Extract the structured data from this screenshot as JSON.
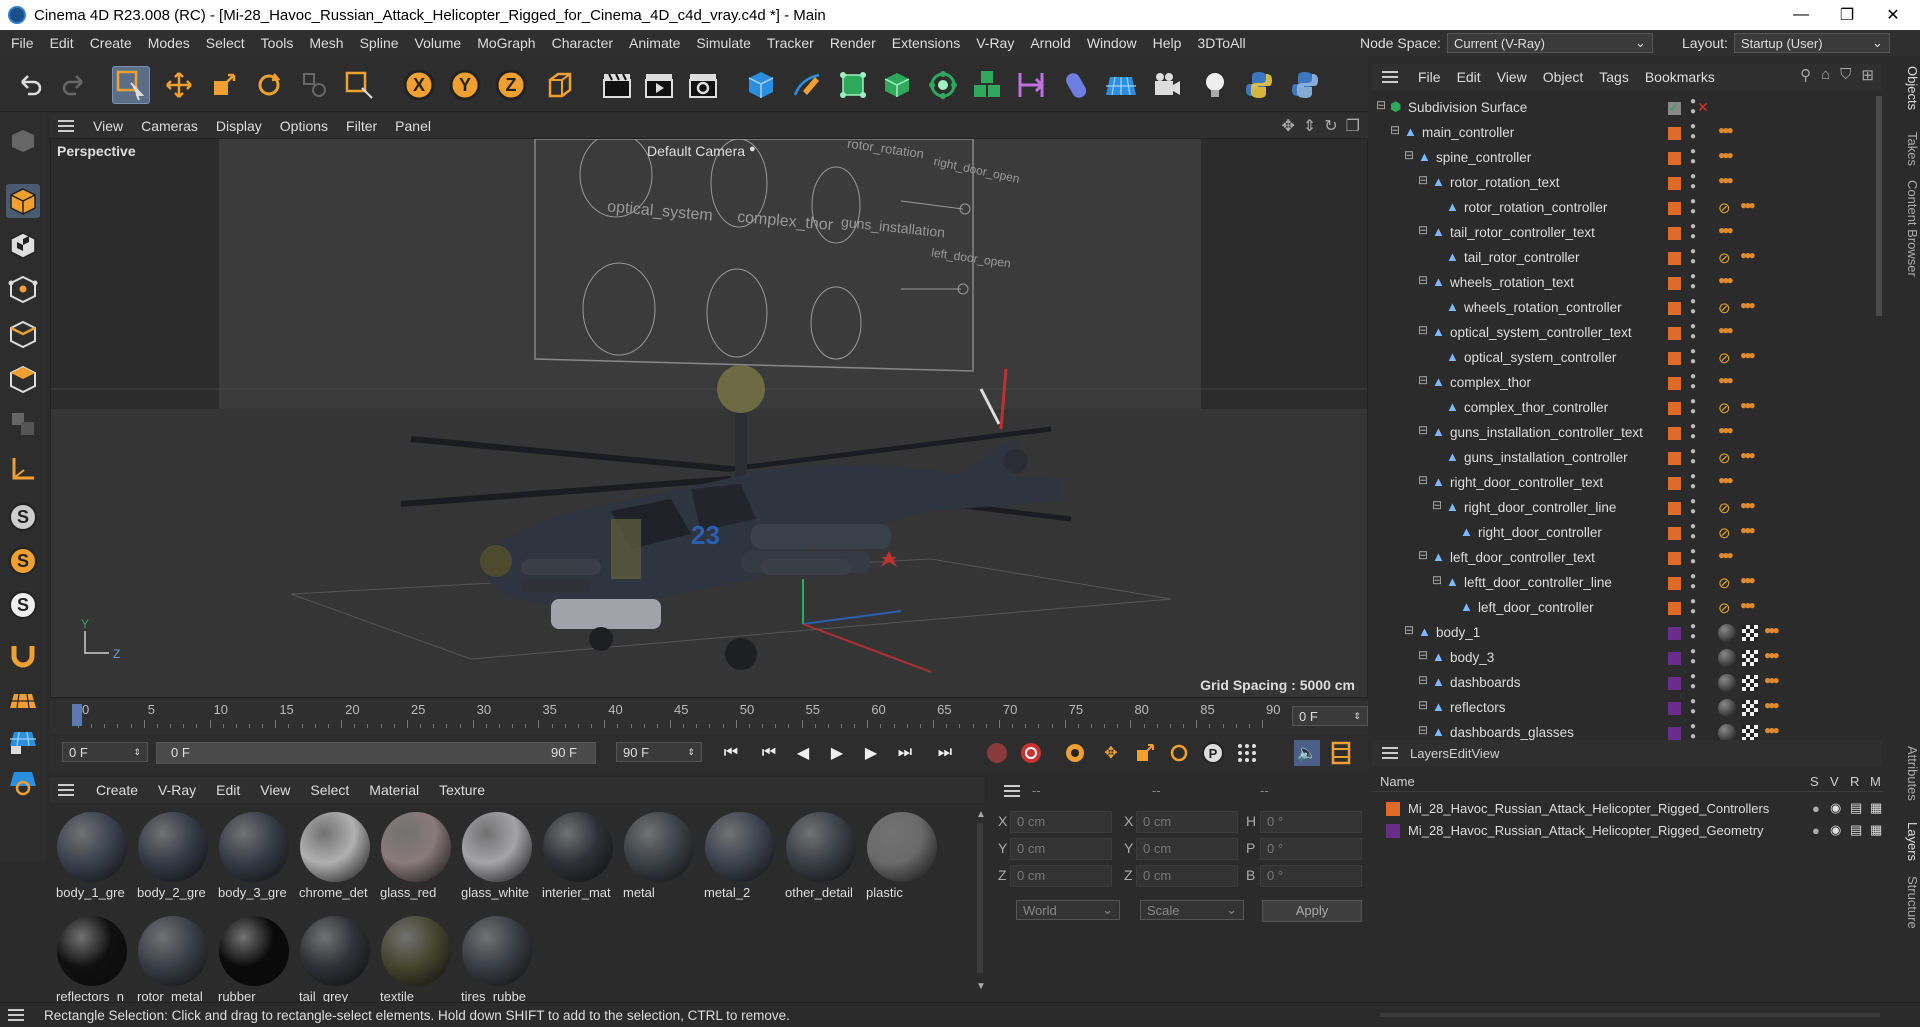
{
  "window": {
    "title": "Cinema 4D R23.008 (RC) - [Mi-28_Havoc_Russian_Attack_Helicopter_Rigged_for_Cinema_4D_c4d_vray.c4d *] - Main",
    "min": "—",
    "max": "❐",
    "close": "✕"
  },
  "menubar": {
    "items": [
      "File",
      "Edit",
      "Create",
      "Modes",
      "Select",
      "Tools",
      "Mesh",
      "Spline",
      "Volume",
      "MoGraph",
      "Character",
      "Animate",
      "Simulate",
      "Tracker",
      "Render",
      "Extensions",
      "V-Ray",
      "Arnold",
      "Window",
      "Help",
      "3DToAll"
    ],
    "node_space_label": "Node Space:",
    "node_space_value": "Current (V-Ray)",
    "layout_label": "Layout:",
    "layout_value": "Startup (User)"
  },
  "viewport": {
    "menu": [
      "View",
      "Cameras",
      "Display",
      "Options",
      "Filter",
      "Panel"
    ],
    "name": "Perspective",
    "camera": "Default Camera",
    "grid_spacing": "Grid Spacing : 5000 cm",
    "labels": {
      "rotor": "rotor_rotation",
      "right_door": "right_door_open",
      "optical": "optical_system",
      "complex": "complex_thor",
      "guns": "guns_installation",
      "left_door": "left_door_open"
    },
    "axis_y": "Y",
    "axis_z": "Z"
  },
  "timeline": {
    "ticks": [
      "0",
      "5",
      "10",
      "15",
      "20",
      "25",
      "30",
      "35",
      "40",
      "45",
      "50",
      "55",
      "60",
      "65",
      "70",
      "75",
      "80",
      "85",
      "90"
    ],
    "current_frame": "0 F"
  },
  "timecontrol": {
    "start": "0 F",
    "range_start": "0 F",
    "range_end": "90 F",
    "end": "90 F"
  },
  "materials": {
    "menu": [
      "Create",
      "V-Ray",
      "Edit",
      "View",
      "Select",
      "Material",
      "Texture"
    ],
    "items": [
      {
        "name": "body_1_gre",
        "color": "#3b4350"
      },
      {
        "name": "body_2_gre",
        "color": "#353c48"
      },
      {
        "name": "body_3_gre",
        "color": "#363d48"
      },
      {
        "name": "chrome_det",
        "color": "#b0b0b0"
      },
      {
        "name": "glass_red",
        "color": "#8a7a7c"
      },
      {
        "name": "glass_white",
        "color": "#a3a3a8"
      },
      {
        "name": "interier_mat",
        "color": "#2e3238"
      },
      {
        "name": "metal",
        "color": "#3c4248"
      },
      {
        "name": "metal_2",
        "color": "#3d4450"
      },
      {
        "name": "other_detail",
        "color": "#3a4048"
      },
      {
        "name": "plastic",
        "color": "#6a6a6a"
      },
      {
        "name": "reflectors_n",
        "color": "#101010"
      },
      {
        "name": "rotor_metal",
        "color": "#3a3f48"
      },
      {
        "name": "rubber",
        "color": "#0a0a0a"
      },
      {
        "name": "tail_grey",
        "color": "#303238"
      },
      {
        "name": "textile",
        "color": "#45462e"
      },
      {
        "name": "tires_rubbe",
        "color": "#3a3e46"
      }
    ]
  },
  "coordinates": {
    "header": [
      "--",
      "--",
      "--"
    ],
    "rows": [
      {
        "a": "X",
        "av": "0 cm",
        "b": "X",
        "bv": "0 cm",
        "c": "H",
        "cv": "0 °"
      },
      {
        "a": "Y",
        "av": "0 cm",
        "b": "Y",
        "bv": "0 cm",
        "c": "P",
        "cv": "0 °"
      },
      {
        "a": "Z",
        "av": "0 cm",
        "b": "Z",
        "bv": "0 cm",
        "c": "B",
        "cv": "0 °"
      }
    ],
    "mode": "World",
    "scale": "Scale",
    "apply": "Apply"
  },
  "objects": {
    "menu": [
      "File",
      "Edit",
      "View",
      "Object",
      "Tags",
      "Bookmarks"
    ],
    "rows": [
      {
        "name": "Subdivision Surface",
        "depth": 0,
        "color": "#888888",
        "tags": "check"
      },
      {
        "name": "main_controller",
        "depth": 1,
        "color": "#e06a2a",
        "tags": "dots"
      },
      {
        "name": "spine_controller",
        "depth": 2,
        "color": "#e06a2a",
        "tags": "dots"
      },
      {
        "name": "rotor_rotation_text",
        "depth": 3,
        "color": "#e06a2a",
        "tags": "dots"
      },
      {
        "name": "rotor_rotation_controller",
        "depth": 4,
        "color": "#e06a2a",
        "tags": "nodots"
      },
      {
        "name": "tail_rotor_controller_text",
        "depth": 3,
        "color": "#e06a2a",
        "tags": "dots"
      },
      {
        "name": "tail_rotor_controller",
        "depth": 4,
        "color": "#e06a2a",
        "tags": "nodots"
      },
      {
        "name": "wheels_rotation_text",
        "depth": 3,
        "color": "#e06a2a",
        "tags": "dots"
      },
      {
        "name": "wheels_rotation_controller",
        "depth": 4,
        "color": "#e06a2a",
        "tags": "nodots"
      },
      {
        "name": "optical_system_controller_text",
        "depth": 3,
        "color": "#e06a2a",
        "tags": "dots"
      },
      {
        "name": "optical_system_controller",
        "depth": 4,
        "color": "#e06a2a",
        "tags": "nodots"
      },
      {
        "name": "complex_thor",
        "depth": 3,
        "color": "#e06a2a",
        "tags": "dots"
      },
      {
        "name": "complex_thor_controller",
        "depth": 4,
        "color": "#e06a2a",
        "tags": "nodots"
      },
      {
        "name": "guns_installation_controller_text",
        "depth": 3,
        "color": "#e06a2a",
        "tags": "dots"
      },
      {
        "name": "guns_installation_controller",
        "depth": 4,
        "color": "#e06a2a",
        "tags": "nodots"
      },
      {
        "name": "right_door_controller_text",
        "depth": 3,
        "color": "#e06a2a",
        "tags": "dots"
      },
      {
        "name": "right_door_controller_line",
        "depth": 4,
        "color": "#e06a2a",
        "tags": "nodots"
      },
      {
        "name": "right_door_controller",
        "depth": 5,
        "color": "#e06a2a",
        "tags": "nodots"
      },
      {
        "name": "left_door_controller_text",
        "depth": 3,
        "color": "#e06a2a",
        "tags": "dots"
      },
      {
        "name": "leftt_door_controller_line",
        "depth": 4,
        "color": "#e06a2a",
        "tags": "nodots"
      },
      {
        "name": "left_door_controller",
        "depth": 5,
        "color": "#e06a2a",
        "tags": "nodots"
      },
      {
        "name": "body_1",
        "depth": 2,
        "color": "#6a2c8a",
        "tags": "mat"
      },
      {
        "name": "body_3",
        "depth": 3,
        "color": "#6a2c8a",
        "tags": "mat"
      },
      {
        "name": "dashboards",
        "depth": 3,
        "color": "#6a2c8a",
        "tags": "mat"
      },
      {
        "name": "reflectors",
        "depth": 3,
        "color": "#6a2c8a",
        "tags": "mat"
      },
      {
        "name": "dashboards_glasses",
        "depth": 3,
        "color": "#6a2c8a",
        "tags": "mat"
      }
    ]
  },
  "layers": {
    "menu": [
      "Layers",
      "Edit",
      "View"
    ],
    "col_name": "Name",
    "cols": [
      "S",
      "V",
      "R",
      "M"
    ],
    "rows": [
      {
        "name": "Mi_28_Havoc_Russian_Attack_Helicopter_Rigged_Controllers",
        "color": "#e06a2a"
      },
      {
        "name": "Mi_28_Havoc_Russian_Attack_Helicopter_Rigged_Geometry",
        "color": "#6a2c8a"
      }
    ]
  },
  "side_tabs": {
    "top": [
      "Objects",
      "Takes",
      "Content Browser"
    ],
    "bottom": [
      "Attributes",
      "Layers",
      "Structure"
    ]
  },
  "status": {
    "text": "Rectangle Selection: Click and drag to rectangle-select elements. Hold down SHIFT to add to the selection, CTRL to remove."
  }
}
